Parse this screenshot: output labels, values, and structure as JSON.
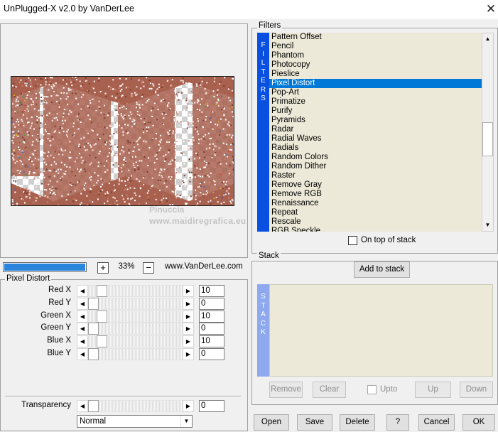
{
  "window": {
    "title": "UnPlugged-X v2.0 by VanDerLee",
    "close_glyph": "✕"
  },
  "preview": {
    "watermark_line1": "Pinuccia",
    "watermark_line2": "www.maidiregrafica.eu",
    "colors": {
      "brown": "#a9614f",
      "white": "#ffffff"
    }
  },
  "zoom": {
    "progress": 1.0,
    "plus": "+",
    "value": "33%",
    "minus": "−",
    "website": "www.VanDerLee.com"
  },
  "params": {
    "group_label": "Pixel Distort",
    "sliders": [
      {
        "label": "Red X",
        "value": "10",
        "fraction": 0.1
      },
      {
        "label": "Red Y",
        "value": "0",
        "fraction": 0.0
      },
      {
        "label": "Green X",
        "value": "10",
        "fraction": 0.1
      },
      {
        "label": "Green Y",
        "value": "0",
        "fraction": 0.0
      },
      {
        "label": "Blue X",
        "value": "10",
        "fraction": 0.1
      },
      {
        "label": "Blue Y",
        "value": "0",
        "fraction": 0.0
      }
    ],
    "transparency": {
      "label": "Transparency",
      "value": "0",
      "fraction": 0.0
    },
    "blend_mode": "Normal"
  },
  "filters": {
    "group_label": "Filters",
    "vertical_label": [
      "F",
      "I",
      "L",
      "T",
      "E",
      "R",
      "S"
    ],
    "items": [
      "Pattern Offset",
      "Pencil",
      "Phantom",
      "Photocopy",
      "Pieslice",
      "Pixel Distort",
      "Pop-Art",
      "Primatize",
      "Purify",
      "Pyramids",
      "Radar",
      "Radial Waves",
      "Radials",
      "Random Colors",
      "Random Dither",
      "Raster",
      "Remove Gray",
      "Remove RGB",
      "Renaissance",
      "Repeat",
      "Rescale",
      "RGB Speckle"
    ],
    "selected": "Pixel Distort",
    "on_top_label": "On top of stack",
    "on_top_checked": false
  },
  "stack": {
    "group_label": "Stack",
    "add_label": "Add to stack",
    "vertical_label": [
      "S",
      "T",
      "A",
      "C",
      "K"
    ],
    "remove_label": "Remove",
    "clear_label": "Clear",
    "upto_label": "Upto",
    "up_label": "Up",
    "down_label": "Down"
  },
  "buttons": {
    "open": "Open",
    "save": "Save",
    "delete": "Delete",
    "help": "?",
    "cancel": "Cancel",
    "ok": "OK"
  },
  "icons": {
    "arrow_left": "◀",
    "arrow_right": "▶",
    "arrow_up": "▲",
    "arrow_down": "▼",
    "close": "close-icon"
  }
}
